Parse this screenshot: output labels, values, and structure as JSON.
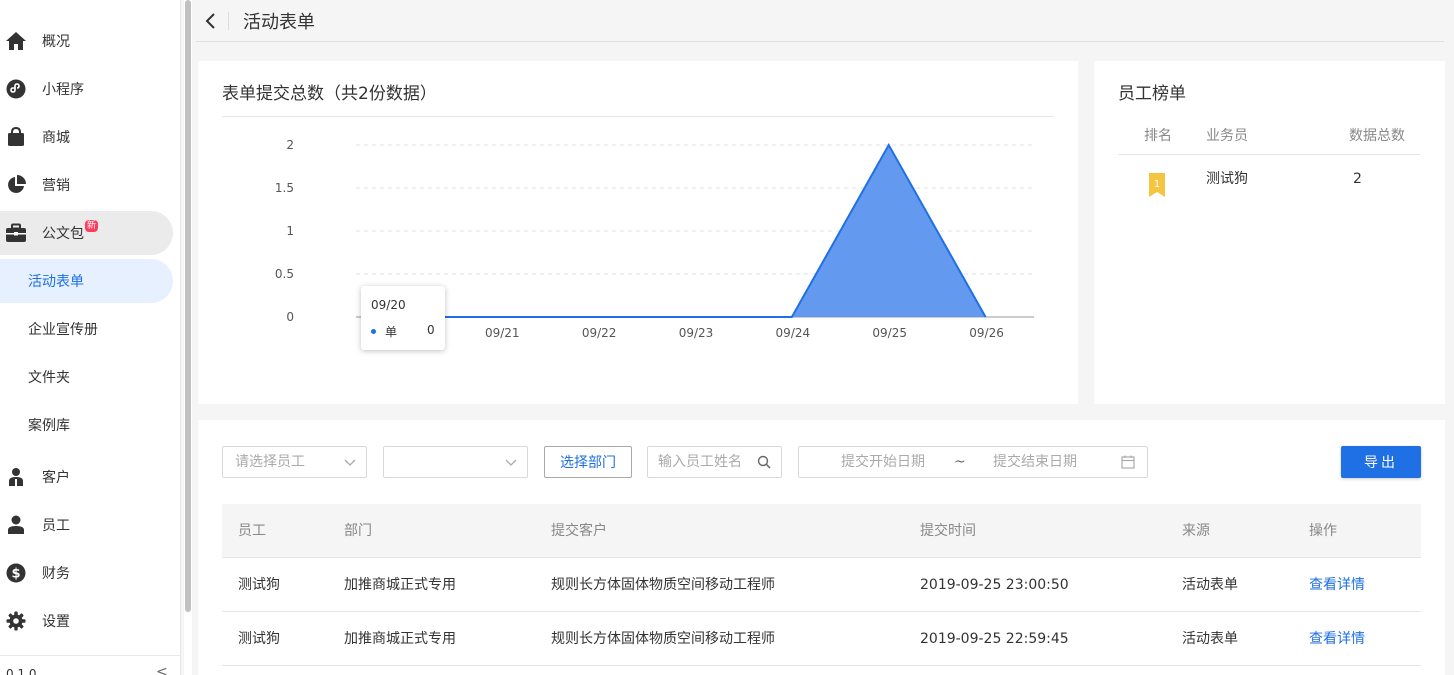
{
  "sidebar": {
    "items": [
      {
        "label": "概况",
        "icon": "home-icon"
      },
      {
        "label": "小程序",
        "icon": "mini-program-icon"
      },
      {
        "label": "商城",
        "icon": "shopping-bag-icon"
      },
      {
        "label": "营销",
        "icon": "pie-chart-icon"
      },
      {
        "label": "公文包",
        "icon": "briefcase-icon",
        "badge": "新"
      },
      {
        "label": "活动表单"
      },
      {
        "label": "企业宣传册"
      },
      {
        "label": "文件夹"
      },
      {
        "label": "案例库"
      },
      {
        "label": "客户",
        "icon": "customer-icon"
      },
      {
        "label": "员工",
        "icon": "user-icon"
      },
      {
        "label": "财务",
        "icon": "dollar-icon"
      },
      {
        "label": "设置",
        "icon": "gear-icon"
      }
    ],
    "version": "0.1.0",
    "collapse_glyph": "<"
  },
  "header": {
    "back_glyph": "<",
    "title": "活动表单"
  },
  "chart_card": {
    "title": "表单提交总数（共2份数据）"
  },
  "chart_data": {
    "type": "area",
    "x": [
      "09/20",
      "09/21",
      "09/22",
      "09/23",
      "09/24",
      "09/25",
      "09/26"
    ],
    "series": [
      {
        "name": "单",
        "values": [
          0,
          0,
          0,
          0,
          0,
          2,
          0
        ]
      }
    ],
    "y_ticks": [
      "2",
      "1.5",
      "1",
      "0.5",
      "0"
    ],
    "ylim": [
      0,
      2
    ],
    "grid": true,
    "tooltip": {
      "date": "09/20",
      "series": "单",
      "value": "0"
    },
    "colors": {
      "fill": "#5b95ee",
      "stroke": "#1f6fe5"
    }
  },
  "rank_card": {
    "title": "员工榜单",
    "columns": [
      "排名",
      "业务员",
      "数据总数"
    ],
    "rows": [
      {
        "rank": "1",
        "name": "测试狗",
        "total": "2"
      }
    ]
  },
  "filters": {
    "employee_placeholder": "请选择员工",
    "second_select_value": "",
    "dept_button": "选择部门",
    "name_search_placeholder": "输入员工姓名",
    "start_date_placeholder": "提交开始日期",
    "range_sep": "~",
    "end_date_placeholder": "提交结束日期",
    "export_button": "导出"
  },
  "table": {
    "columns": [
      "员工",
      "部门",
      "提交客户",
      "提交时间",
      "来源",
      "操作"
    ],
    "rows": [
      {
        "employee": "测试狗",
        "dept": "加推商城正式专用",
        "customer": "规则长方体固体物质空间移动工程师",
        "time": "2019-09-25 23:00:50",
        "source": "活动表单",
        "action": "查看详情"
      },
      {
        "employee": "测试狗",
        "dept": "加推商城正式专用",
        "customer": "规则长方体固体物质空间移动工程师",
        "time": "2019-09-25 22:59:45",
        "source": "活动表单",
        "action": "查看详情"
      }
    ]
  },
  "colors": {
    "accent": "#1f6fe5",
    "badge": "#ff3b5c"
  }
}
